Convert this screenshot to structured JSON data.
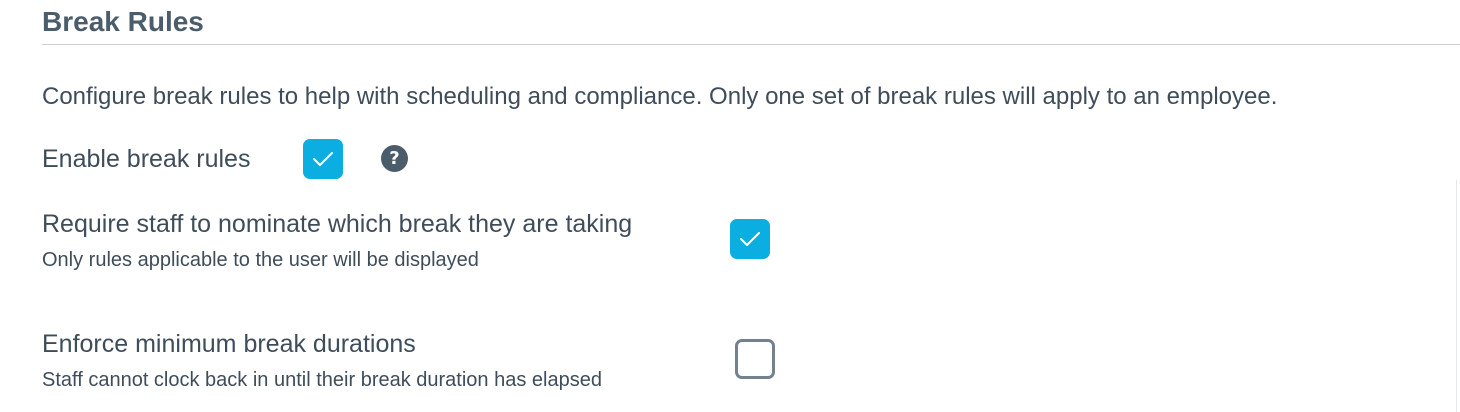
{
  "section": {
    "title": "Break Rules",
    "description": "Configure break rules to help with scheduling and compliance. Only one set of break rules will apply to an employee."
  },
  "settings": {
    "enable_break_rules": {
      "label": "Enable break rules",
      "checked": true,
      "help_icon": "question-circle-icon",
      "help_glyph": "?"
    },
    "nominate_break": {
      "label": "Require staff to nominate which break they are taking",
      "sublabel": "Only rules applicable to the user will be displayed",
      "checked": true
    },
    "enforce_min_duration": {
      "label": "Enforce minimum break durations",
      "sublabel": "Staff cannot clock back in until their break duration has elapsed",
      "checked": false
    }
  },
  "colors": {
    "accent": "#0aaee0",
    "text": "#3f4d5a",
    "heading": "#4b5c6b",
    "unchecked_border": "#74828f"
  }
}
